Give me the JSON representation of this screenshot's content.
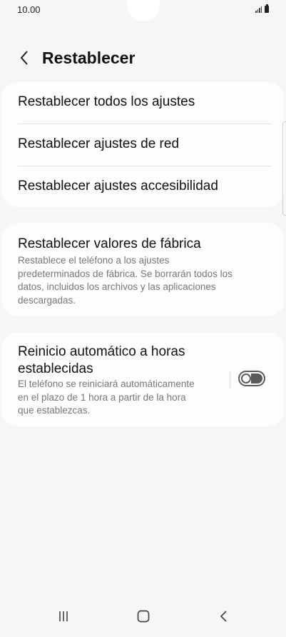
{
  "status_bar": {
    "time": "10.00"
  },
  "header": {
    "title": "Restablecer"
  },
  "reset_options": [
    {
      "label": "Restablecer todos los ajustes"
    },
    {
      "label": "Restablecer ajustes de red"
    },
    {
      "label": "Restablecer ajustes accesibilidad"
    }
  ],
  "factory_reset": {
    "title": "Restablecer valores de fábrica",
    "description_lines": [
      "Restablece el teléfono a los ajustes",
      "predeterminados de fábrica. Se borrarán todos los",
      "datos, incluidos los archivos y las aplicaciones",
      "descargadas."
    ]
  },
  "auto_restart": {
    "title_lines": [
      "Reinicio automático a horas",
      "establecidas"
    ],
    "description_lines": [
      "El teléfono se reiniciará automáticamente",
      "en el plazo de 1 hora a partir de la hora",
      "que establezcas."
    ],
    "toggle_on": false
  },
  "colors": {
    "background": "#f6f6f6",
    "card": "#fdfdfd",
    "secondary_text": "#777777"
  }
}
